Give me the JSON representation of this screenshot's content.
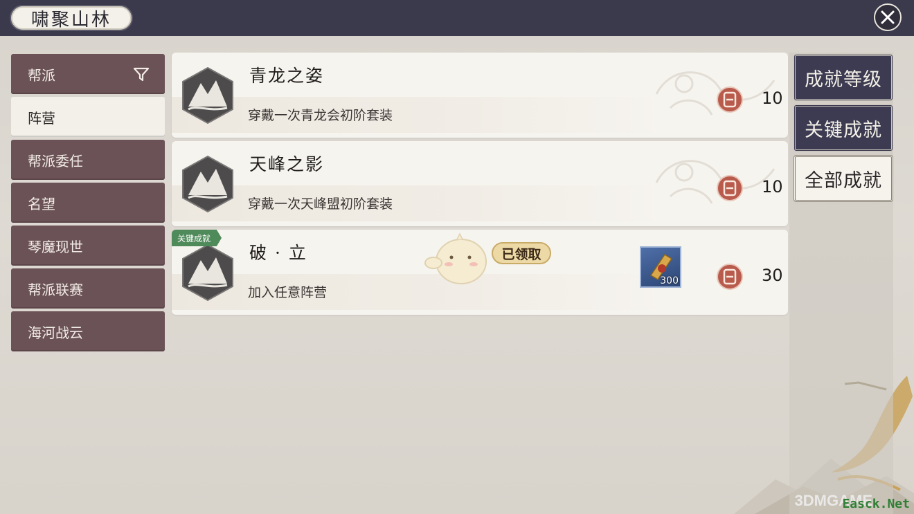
{
  "header": {
    "title": "啸聚山林"
  },
  "sidebar": {
    "items": [
      {
        "label": "帮派",
        "active": false,
        "has_filter": true
      },
      {
        "label": "阵营",
        "active": true,
        "has_filter": false
      },
      {
        "label": "帮派委任",
        "active": false,
        "has_filter": false
      },
      {
        "label": "名望",
        "active": false,
        "has_filter": false
      },
      {
        "label": "琴魔现世",
        "active": false,
        "has_filter": false
      },
      {
        "label": "帮派联赛",
        "active": false,
        "has_filter": false
      },
      {
        "label": "海河战云",
        "active": false,
        "has_filter": false
      }
    ]
  },
  "achievements": [
    {
      "name": "青龙之姿",
      "desc": "穿戴一次青龙会初阶套装",
      "points": "10"
    },
    {
      "name": "天峰之影",
      "desc": "穿戴一次天峰盟初阶套装",
      "points": "10"
    },
    {
      "name": "破 · 立",
      "desc": "加入任意阵营",
      "points": "30",
      "badge": "关键成就",
      "status": "已领取",
      "reward_qty": "300"
    }
  ],
  "tabs": [
    {
      "label": "成就等级",
      "active": false
    },
    {
      "label": "关键成就",
      "active": false
    },
    {
      "label": "全部成就",
      "active": true
    }
  ],
  "watermark": {
    "site": "Easck.Net",
    "brand": "3DMGAME"
  },
  "colors": {
    "header_bg": "#3b3a4c",
    "sidebar_item": "#6b5256",
    "tab_dark": "#3c3b51",
    "badge_green": "#4f8a5a",
    "claimed_gold": "#ecd9a6"
  }
}
